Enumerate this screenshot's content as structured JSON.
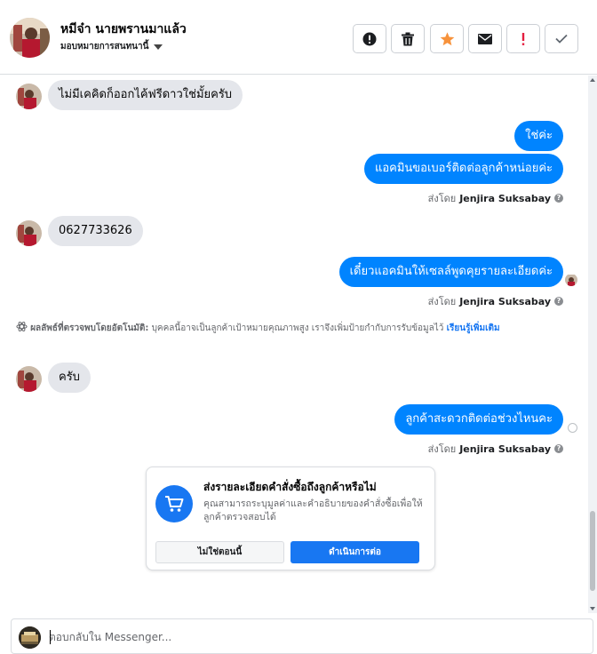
{
  "header": {
    "contact_name": "หมีจ๋า นายพรานมาแล้ว",
    "assign_label": "มอบหมายการสนทนานี้",
    "actions": [
      {
        "name": "spam",
        "glyph": "!"
      },
      {
        "name": "delete",
        "glyph": "trash"
      },
      {
        "name": "star",
        "glyph": "★"
      },
      {
        "name": "mark-unread",
        "glyph": "envelope"
      },
      {
        "name": "follow-up",
        "glyph": "!"
      },
      {
        "name": "done",
        "glyph": "✓"
      }
    ]
  },
  "messages": {
    "m1": "ไม่มีเคคิดก็ออกไค้ฟรีดาวใช่มั้ยครับ",
    "m2": "ใช่ค่ะ",
    "m3": "แอคมินขอเบอร์ติดต่อลูกค้าหน่อยค่ะ",
    "m4": "0627733626",
    "m5": "เดี๋ยวแอคมินให้เซลล์พูดคุยรายละเอียดค่ะ",
    "m6": "ครับ",
    "m7": "ลูกค้าสะดวกติดต่อช่วงไหนคะ"
  },
  "sent_by": {
    "prefix": "ส่งโดย",
    "agent": "Jenjira Suksabay",
    "info": "?"
  },
  "auto_detect": {
    "label": "ผลลัพธ์ที่ตรวจพบโดยอัตโนมัติ:",
    "text": "บุคคลนี้อาจเป็นลูกค้าเป้าหมายคุณภาพสูง เราจึงเพิ่มป้ายกำกับการรับข้อมูลไว้",
    "more": "เรียนรู้เพิ่มเติม"
  },
  "order_card": {
    "title": "ส่งรายละเอียดคำสั่งซื้อถึงลูกค้าหรือไม่",
    "description": "คุณสามารถระบุมูลค่าและคำอธิบายของคำสั่งซื้อเพื่อให้ลูกค้าตรวจสอบได้",
    "not_now": "ไม่ใช่ตอนนี้",
    "continue": "ดำเนินการต่อ"
  },
  "composer": {
    "placeholder": "ตอบกลับใน Messenger..."
  },
  "colors": {
    "outgoing_bubble": "#0084ff",
    "incoming_bubble": "#e4e6eb",
    "star": "#f7923b",
    "follow_up": "#e41e3f",
    "brand_blue": "#1877f2"
  }
}
